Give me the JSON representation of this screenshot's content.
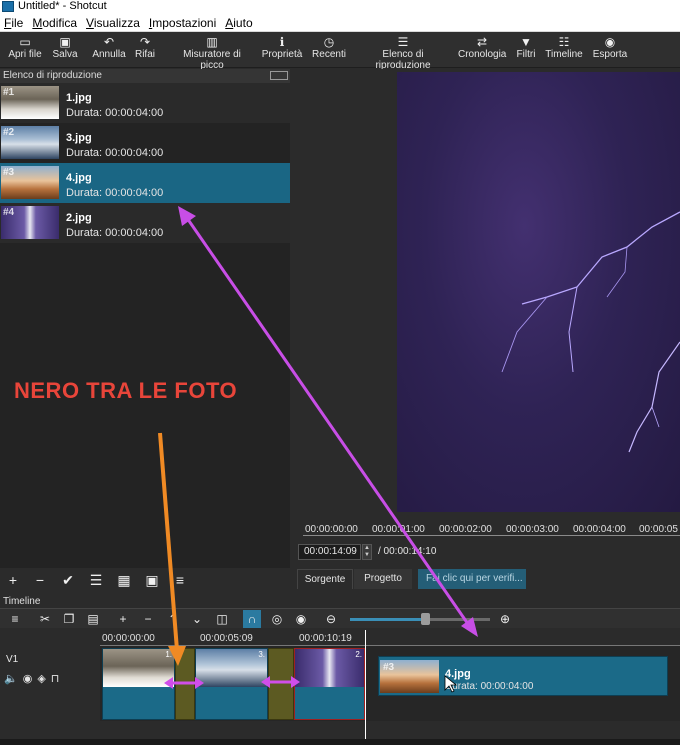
{
  "window": {
    "title": "Untitled* - Shotcut"
  },
  "menu": [
    "File",
    "Modifica",
    "Visualizza",
    "Impostazioni",
    "Aiuto"
  ],
  "toolbar": {
    "open": "Apri file",
    "save": "Salva",
    "undo": "Annulla",
    "redo": "Rifai",
    "peak": "Misuratore di picco",
    "props": "Proprietà",
    "recent": "Recenti",
    "playlist": "Elenco di riproduzione",
    "history": "Cronologia",
    "filters": "Filtri",
    "timeline": "Timeline",
    "export": "Esporta"
  },
  "playlist": {
    "title": "Elenco di riproduzione",
    "items": [
      {
        "num": "#1",
        "name": "1.jpg",
        "duration": "Durata: 00:00:04:00"
      },
      {
        "num": "#2",
        "name": "3.jpg",
        "duration": "Durata: 00:00:04:00"
      },
      {
        "num": "#3",
        "name": "4.jpg",
        "duration": "Durata: 00:00:04:00",
        "selected": true
      },
      {
        "num": "#4",
        "name": "2.jpg",
        "duration": "Durata: 00:00:04:00"
      }
    ]
  },
  "player": {
    "ruler": [
      "00:00:00:00",
      "00:00:01:00",
      "00:00:02:00",
      "00:00:03:00",
      "00:00:04:00",
      "00:00:05"
    ],
    "current_timecode": "00:00:14:09",
    "total_timecode": "/ 00:00:14:10",
    "tab_source": "Sorgente",
    "tab_project": "Progetto",
    "verify_hint": "Fai clic qui per verifi..."
  },
  "timeline": {
    "title": "Timeline",
    "ruler": [
      "00:00:00:00",
      "00:00:05:09",
      "00:00:10:19"
    ],
    "track_name": "V1",
    "clip_labels": [
      "1.",
      "3.",
      "2."
    ],
    "drag_clip": {
      "num": "#3",
      "name": "4.jpg",
      "duration": "Durata: 00:00:04:00"
    }
  },
  "annotation": {
    "text": "NERO TRA LE FOTO",
    "color": "#e8453a",
    "arrow_orange": "#f08a24",
    "arrow_purple": "#c84ee6"
  },
  "colors": {
    "selection": "#1a6684",
    "clip": "#1b6a88",
    "gap": "#5c5a22"
  }
}
